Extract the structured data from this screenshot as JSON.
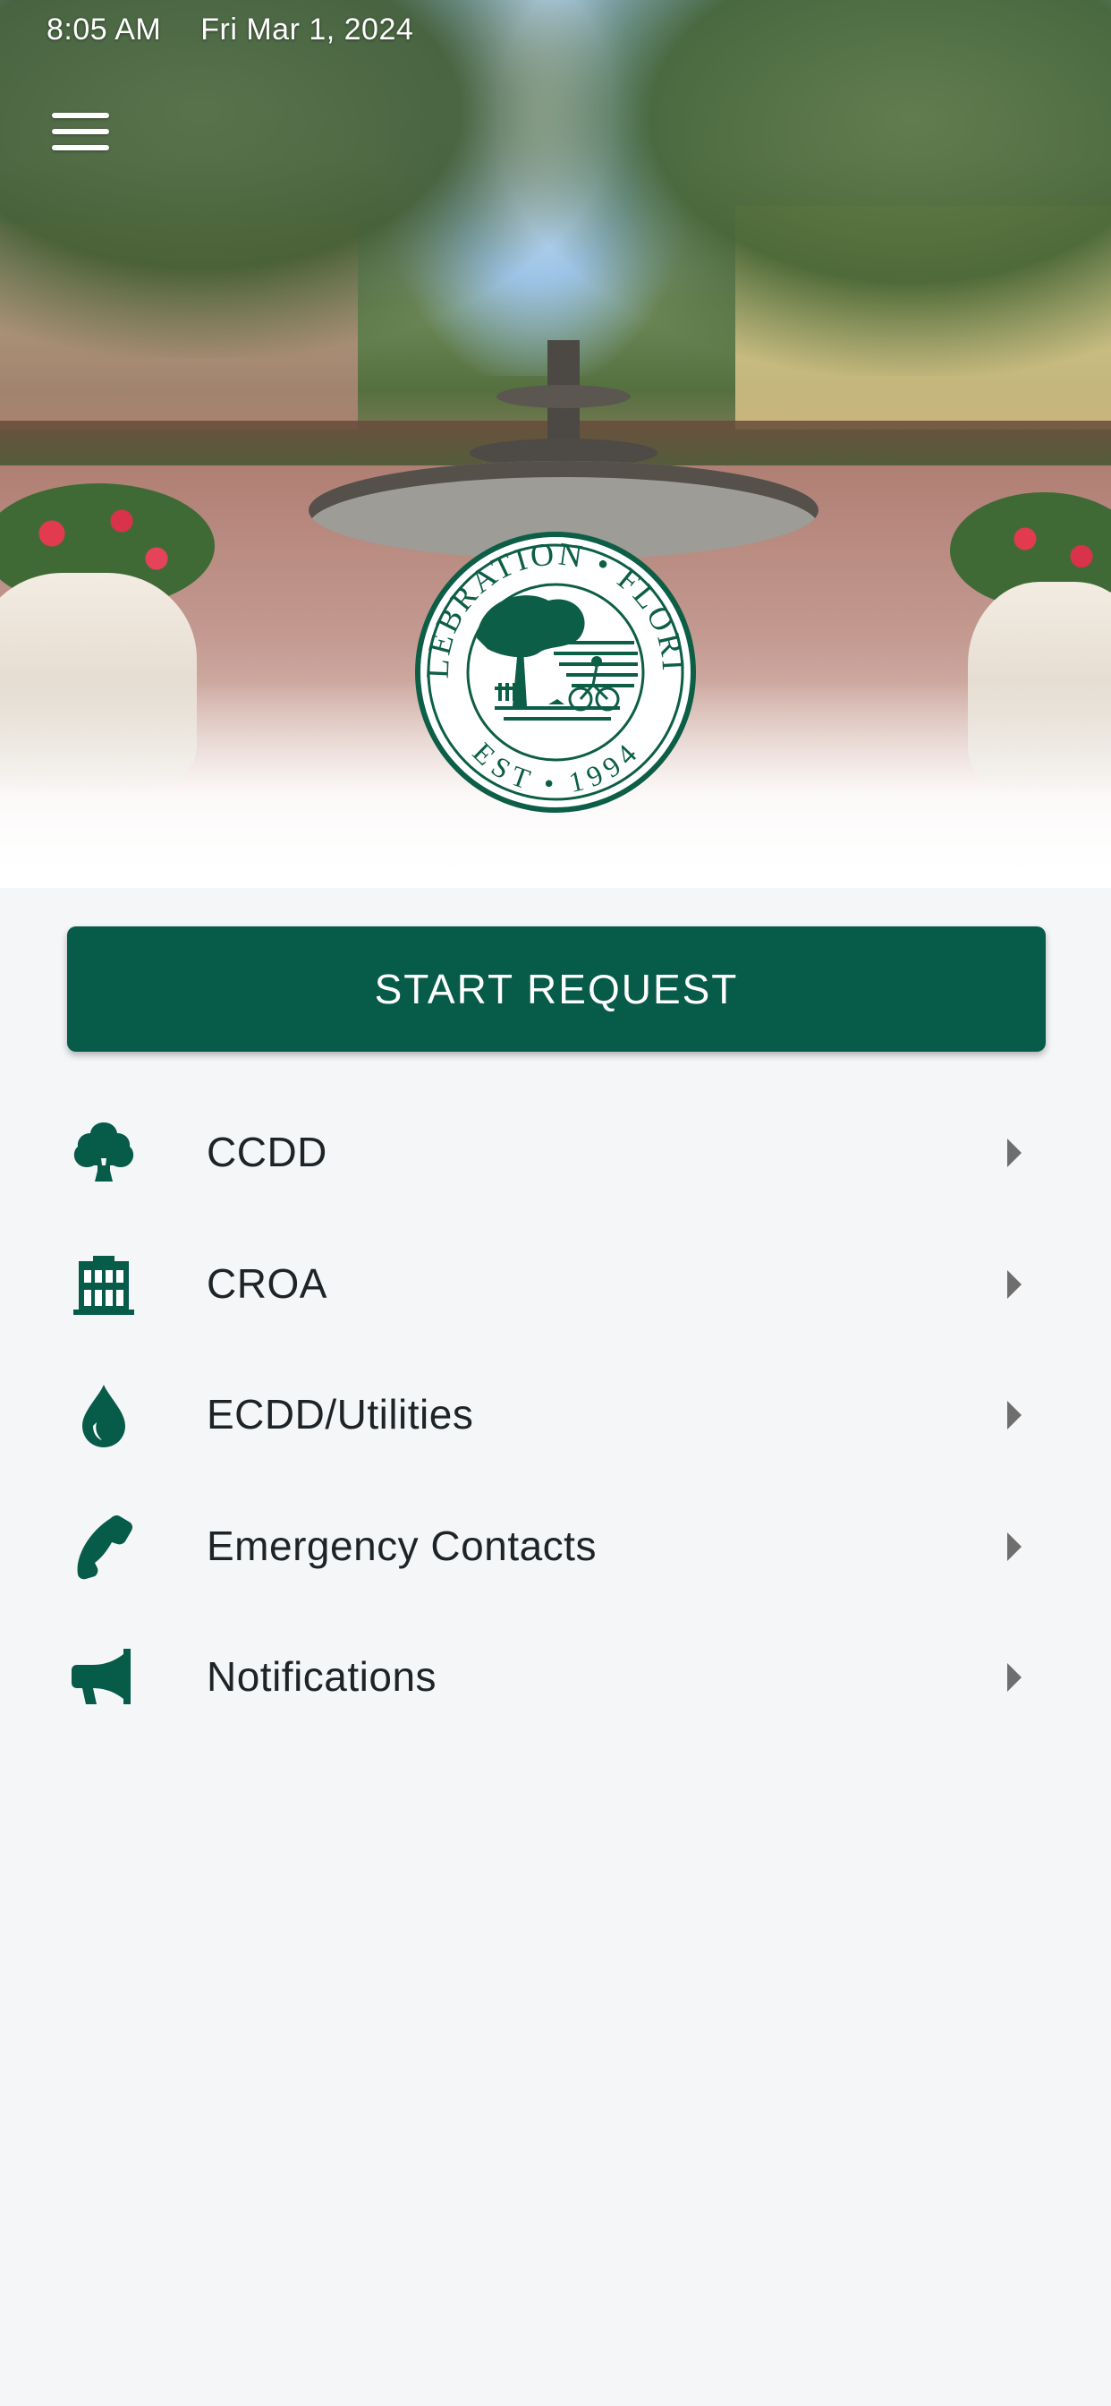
{
  "status_bar": {
    "time": "8:05 AM",
    "date": "Fri Mar 1, 2024"
  },
  "header": {
    "menu_icon": "hamburger-menu-icon"
  },
  "seal": {
    "top_text": "CELEBRATION • FLORIDA",
    "bottom_text": "EST • 1994",
    "icon": "celebration-florida-seal-logo"
  },
  "start_request": {
    "label": "START REQUEST"
  },
  "menu": {
    "items": [
      {
        "label": "CCDD",
        "icon": "tree-icon"
      },
      {
        "label": "CROA",
        "icon": "building-icon"
      },
      {
        "label": "ECDD/Utilities",
        "icon": "water-drop-icon"
      },
      {
        "label": "Emergency Contacts",
        "icon": "phone-icon"
      },
      {
        "label": "Notifications",
        "icon": "megaphone-icon"
      }
    ]
  },
  "colors": {
    "brand_green": "#065b49",
    "background": "#f4f6f8",
    "text": "#1d2326",
    "chevron": "#6e6e6e"
  }
}
